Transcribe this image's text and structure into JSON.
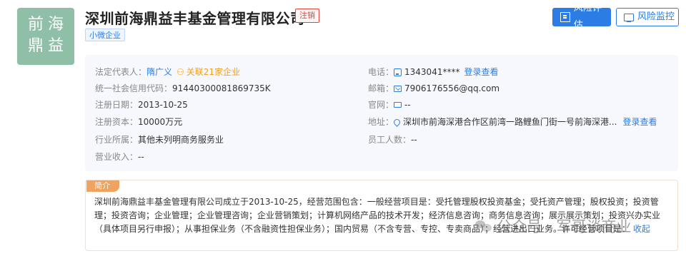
{
  "company": {
    "logo_chars": [
      "前",
      "海",
      "鼎",
      "益"
    ],
    "name": "深圳前海鼎益丰基金管理有限公司",
    "status_tag": "注销",
    "type_tag": "小微企业"
  },
  "actions": {
    "risk_eval_label": "风险评估",
    "risk_monitor_label": "风险监控"
  },
  "info": {
    "legal_rep_label": "法定代表人：",
    "legal_rep_value": "隋广义",
    "related_label": "关联21家企业",
    "credit_code_label": "统一社会信用代码：",
    "credit_code_value": "91440300081869735K",
    "reg_date_label": "注册日期：",
    "reg_date_value": "2013-10-25",
    "reg_capital_label": "注册资本：",
    "reg_capital_value": "10000万元",
    "industry_label": "行业所属：",
    "industry_value": "其他未列明商务服务业",
    "revenue_label": "营业收入：",
    "revenue_value": "--",
    "phone_label": "电话：",
    "phone_value": "1343041****",
    "phone_more": "登录查看",
    "email_label": "邮箱：",
    "email_value": "7906176556@qq.com",
    "website_label": "官网：",
    "website_value": "--",
    "address_label": "地址：",
    "address_value": "深圳市前海深港合作区前湾一路鲤鱼门街一号前海深港...",
    "address_more": "登录查看",
    "employees_label": "员工人数：",
    "employees_value": "--"
  },
  "intro": {
    "tag": "简介",
    "text": "深圳前海鼎益丰基金管理有限公司成立于2013-10-25，经营范围包含：一般经营项目是：受托管理股权投资基金；受托资产管理；股权投资；投资管理；投资咨询；企业管理；企业管理咨询；企业营销策划；计算机网络产品的技术开发；经济信息咨询；商务信息咨询；展示展示策划；投资兴办实业（具体项目另行申报）；从事担保业务（不含融资性担保业务）；国内贸易（不含专营、专控、专卖商品）；经营进出口业务。许可经营项目是：",
    "collapse_label": "收起"
  },
  "watermark": {
    "platform": "公众号",
    "author": "军哥谈商业"
  }
}
